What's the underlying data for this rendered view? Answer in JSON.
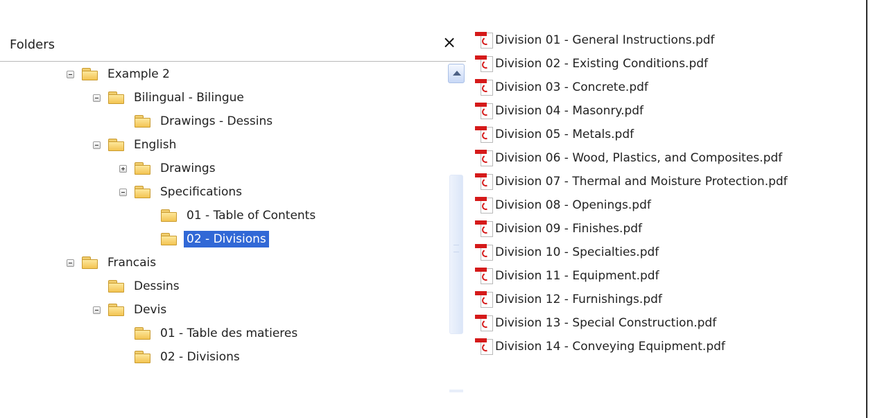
{
  "folders_pane": {
    "title": "Folders",
    "close_label": "×"
  },
  "tree": [
    {
      "label": "Example 2",
      "expander": "expanded"
    },
    {
      "label": "Bilingual - Bilingue",
      "expander": "expanded"
    },
    {
      "label": "Drawings - Dessins",
      "expander": "none"
    },
    {
      "label": "English",
      "expander": "expanded"
    },
    {
      "label": "Drawings",
      "expander": "collapsed"
    },
    {
      "label": "Specifications",
      "expander": "expanded"
    },
    {
      "label": "01 - Table of Contents",
      "expander": "none"
    },
    {
      "label": "02 - Divisions",
      "expander": "none",
      "selected": true
    },
    {
      "label": "Francais",
      "expander": "expanded"
    },
    {
      "label": "Dessins",
      "expander": "none"
    },
    {
      "label": "Devis",
      "expander": "expanded"
    },
    {
      "label": "01 - Table des matieres",
      "expander": "none"
    },
    {
      "label": "02 - Divisions",
      "expander": "none"
    }
  ],
  "files": [
    "Division 01 - General Instructions.pdf",
    "Division 02 - Existing Conditions.pdf",
    "Division 03 - Concrete.pdf",
    "Division 04 - Masonry.pdf",
    "Division 05 - Metals.pdf",
    "Division 06 - Wood, Plastics, and Composites.pdf",
    "Division 07 - Thermal and Moisture Protection.pdf",
    "Division 08 - Openings.pdf",
    "Division 09 - Finishes.pdf",
    "Division 10 - Specialties.pdf",
    "Division 11 - Equipment.pdf",
    "Division 12 - Furnishings.pdf",
    "Division 13 - Special Construction.pdf",
    "Division 14 - Conveying Equipment.pdf"
  ],
  "icons": {
    "folder": "folder-icon",
    "file": "pdf-file-icon",
    "close": "close-icon",
    "scroll_up": "chevron-up-icon"
  },
  "colors": {
    "selection": "#3168d6",
    "pdf_red": "#d51a1a",
    "folder_yellow": "#f3c452"
  }
}
